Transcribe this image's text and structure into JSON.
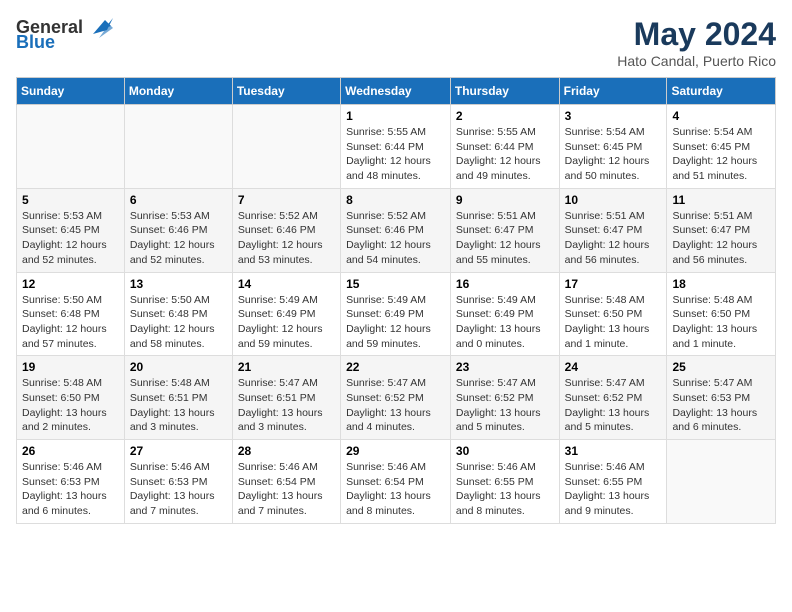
{
  "header": {
    "logo_general": "General",
    "logo_blue": "Blue",
    "month": "May 2024",
    "location": "Hato Candal, Puerto Rico"
  },
  "weekdays": [
    "Sunday",
    "Monday",
    "Tuesday",
    "Wednesday",
    "Thursday",
    "Friday",
    "Saturday"
  ],
  "weeks": [
    [
      {
        "day": "",
        "info": ""
      },
      {
        "day": "",
        "info": ""
      },
      {
        "day": "",
        "info": ""
      },
      {
        "day": "1",
        "info": "Sunrise: 5:55 AM\nSunset: 6:44 PM\nDaylight: 12 hours\nand 48 minutes."
      },
      {
        "day": "2",
        "info": "Sunrise: 5:55 AM\nSunset: 6:44 PM\nDaylight: 12 hours\nand 49 minutes."
      },
      {
        "day": "3",
        "info": "Sunrise: 5:54 AM\nSunset: 6:45 PM\nDaylight: 12 hours\nand 50 minutes."
      },
      {
        "day": "4",
        "info": "Sunrise: 5:54 AM\nSunset: 6:45 PM\nDaylight: 12 hours\nand 51 minutes."
      }
    ],
    [
      {
        "day": "5",
        "info": "Sunrise: 5:53 AM\nSunset: 6:45 PM\nDaylight: 12 hours\nand 52 minutes."
      },
      {
        "day": "6",
        "info": "Sunrise: 5:53 AM\nSunset: 6:46 PM\nDaylight: 12 hours\nand 52 minutes."
      },
      {
        "day": "7",
        "info": "Sunrise: 5:52 AM\nSunset: 6:46 PM\nDaylight: 12 hours\nand 53 minutes."
      },
      {
        "day": "8",
        "info": "Sunrise: 5:52 AM\nSunset: 6:46 PM\nDaylight: 12 hours\nand 54 minutes."
      },
      {
        "day": "9",
        "info": "Sunrise: 5:51 AM\nSunset: 6:47 PM\nDaylight: 12 hours\nand 55 minutes."
      },
      {
        "day": "10",
        "info": "Sunrise: 5:51 AM\nSunset: 6:47 PM\nDaylight: 12 hours\nand 56 minutes."
      },
      {
        "day": "11",
        "info": "Sunrise: 5:51 AM\nSunset: 6:47 PM\nDaylight: 12 hours\nand 56 minutes."
      }
    ],
    [
      {
        "day": "12",
        "info": "Sunrise: 5:50 AM\nSunset: 6:48 PM\nDaylight: 12 hours\nand 57 minutes."
      },
      {
        "day": "13",
        "info": "Sunrise: 5:50 AM\nSunset: 6:48 PM\nDaylight: 12 hours\nand 58 minutes."
      },
      {
        "day": "14",
        "info": "Sunrise: 5:49 AM\nSunset: 6:49 PM\nDaylight: 12 hours\nand 59 minutes."
      },
      {
        "day": "15",
        "info": "Sunrise: 5:49 AM\nSunset: 6:49 PM\nDaylight: 12 hours\nand 59 minutes."
      },
      {
        "day": "16",
        "info": "Sunrise: 5:49 AM\nSunset: 6:49 PM\nDaylight: 13 hours\nand 0 minutes."
      },
      {
        "day": "17",
        "info": "Sunrise: 5:48 AM\nSunset: 6:50 PM\nDaylight: 13 hours\nand 1 minute."
      },
      {
        "day": "18",
        "info": "Sunrise: 5:48 AM\nSunset: 6:50 PM\nDaylight: 13 hours\nand 1 minute."
      }
    ],
    [
      {
        "day": "19",
        "info": "Sunrise: 5:48 AM\nSunset: 6:50 PM\nDaylight: 13 hours\nand 2 minutes."
      },
      {
        "day": "20",
        "info": "Sunrise: 5:48 AM\nSunset: 6:51 PM\nDaylight: 13 hours\nand 3 minutes."
      },
      {
        "day": "21",
        "info": "Sunrise: 5:47 AM\nSunset: 6:51 PM\nDaylight: 13 hours\nand 3 minutes."
      },
      {
        "day": "22",
        "info": "Sunrise: 5:47 AM\nSunset: 6:52 PM\nDaylight: 13 hours\nand 4 minutes."
      },
      {
        "day": "23",
        "info": "Sunrise: 5:47 AM\nSunset: 6:52 PM\nDaylight: 13 hours\nand 5 minutes."
      },
      {
        "day": "24",
        "info": "Sunrise: 5:47 AM\nSunset: 6:52 PM\nDaylight: 13 hours\nand 5 minutes."
      },
      {
        "day": "25",
        "info": "Sunrise: 5:47 AM\nSunset: 6:53 PM\nDaylight: 13 hours\nand 6 minutes."
      }
    ],
    [
      {
        "day": "26",
        "info": "Sunrise: 5:46 AM\nSunset: 6:53 PM\nDaylight: 13 hours\nand 6 minutes."
      },
      {
        "day": "27",
        "info": "Sunrise: 5:46 AM\nSunset: 6:53 PM\nDaylight: 13 hours\nand 7 minutes."
      },
      {
        "day": "28",
        "info": "Sunrise: 5:46 AM\nSunset: 6:54 PM\nDaylight: 13 hours\nand 7 minutes."
      },
      {
        "day": "29",
        "info": "Sunrise: 5:46 AM\nSunset: 6:54 PM\nDaylight: 13 hours\nand 8 minutes."
      },
      {
        "day": "30",
        "info": "Sunrise: 5:46 AM\nSunset: 6:55 PM\nDaylight: 13 hours\nand 8 minutes."
      },
      {
        "day": "31",
        "info": "Sunrise: 5:46 AM\nSunset: 6:55 PM\nDaylight: 13 hours\nand 9 minutes."
      },
      {
        "day": "",
        "info": ""
      }
    ]
  ]
}
